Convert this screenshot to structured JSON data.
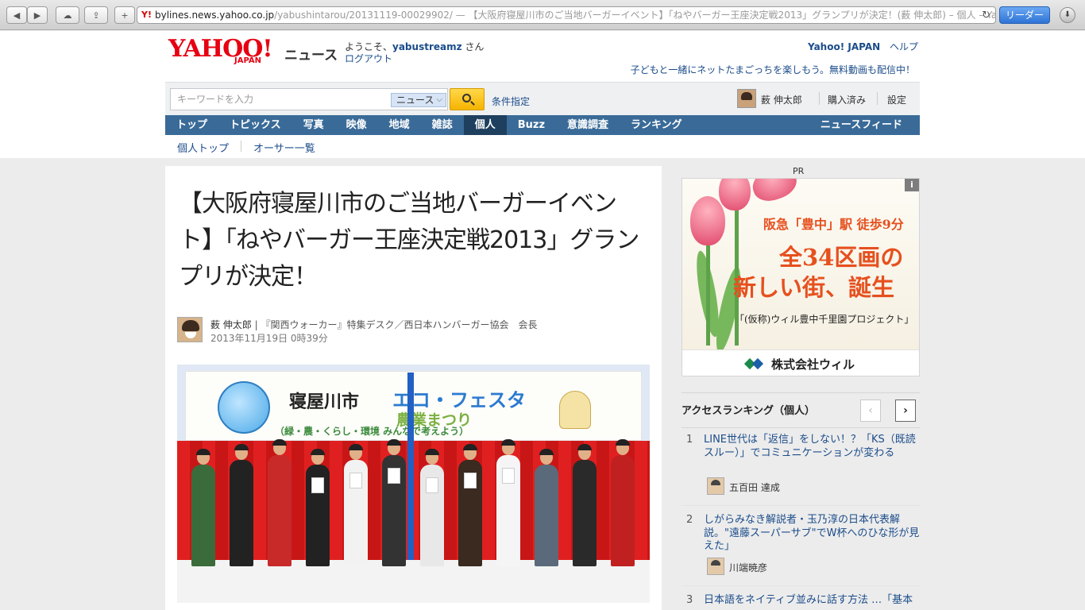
{
  "browser": {
    "url_host": "bylines.news.yahoo.co.jp",
    "url_rest": "/yabushintarou/20131119-00029902/ — 【大阪府寝屋川市のご当地バーガーイベント】「ねやバーガー王座決定戦2013」グランプリが決定！(薮 伸太郎) – 個人 – Yaho...",
    "reader_label": "リーダー",
    "favicon": "Y!"
  },
  "header": {
    "logo_text": "YAHOO!",
    "logo_sub": "JAPAN",
    "section": "ニュース",
    "welcome_prefix": "ようこそ、",
    "username": "yabustreamz",
    "welcome_suffix": " さん",
    "logout": "ログアウト",
    "yahoo_japan": "Yahoo! JAPAN",
    "help": "ヘルプ",
    "promo": "子どもと一緒にネットたまごっちを楽しもう。無料動画も配信中！"
  },
  "search": {
    "placeholder": "キーワードを入力",
    "scope": "ニュース",
    "advanced": "条件指定",
    "user_name": "薮 伸太郎",
    "purchased": "購入済み",
    "settings": "設定"
  },
  "nav": {
    "items": [
      "トップ",
      "トピックス",
      "写真",
      "映像",
      "地域",
      "雑誌",
      "個人",
      "Buzz",
      "意識調査",
      "ランキング"
    ],
    "feed": "ニュースフィード",
    "sub": [
      "個人トップ",
      "オーサー一覧"
    ]
  },
  "article": {
    "title": "【大阪府寝屋川市のご当地バーガーイベント】「ねやバーガー王座決定戦2013」グランプリが決定！",
    "author": "薮 伸太郎",
    "author_sep": " | ",
    "author_desc": "『関西ウォーカー』特集デスク／西日本ハンバーガー協会　会長",
    "date": "2013年11月19日 0時39分",
    "photo": {
      "banner_city": "寝屋川市",
      "banner_eco": "エコ・フェスタ",
      "banner_agri": "農業まつり",
      "banner_sub": "（緑・農・くらし・環境 みんなで考えよう）"
    }
  },
  "sidebar": {
    "pr": "PR",
    "ad": {
      "info": "i",
      "line1": "阪急「豊中」駅 徒歩9分",
      "line2": "全34区画の",
      "line3": "新しい街、誕生",
      "line4": "「(仮称)ウィル豊中千里園プロジェクト」",
      "company": "株式会社ウィル"
    },
    "ranking": {
      "title": "アクセスランキング（個人）",
      "prev": "‹",
      "next": "›",
      "items": [
        {
          "num": "1",
          "text": "LINE世代は「返信」をしない！？「KS（既読スルー）」でコミュニケーションが変わる",
          "author": "五百田 達成"
        },
        {
          "num": "2",
          "text": "しがらみなき解説者・玉乃淳の日本代表解説。\"遠藤スーパーサブ\"でW杯へのひな形が見えた」",
          "author": "川端暁彦"
        },
        {
          "num": "3",
          "text": "日本語をネイティブ並みに話す方法 …「基本",
          "author": ""
        }
      ]
    }
  }
}
